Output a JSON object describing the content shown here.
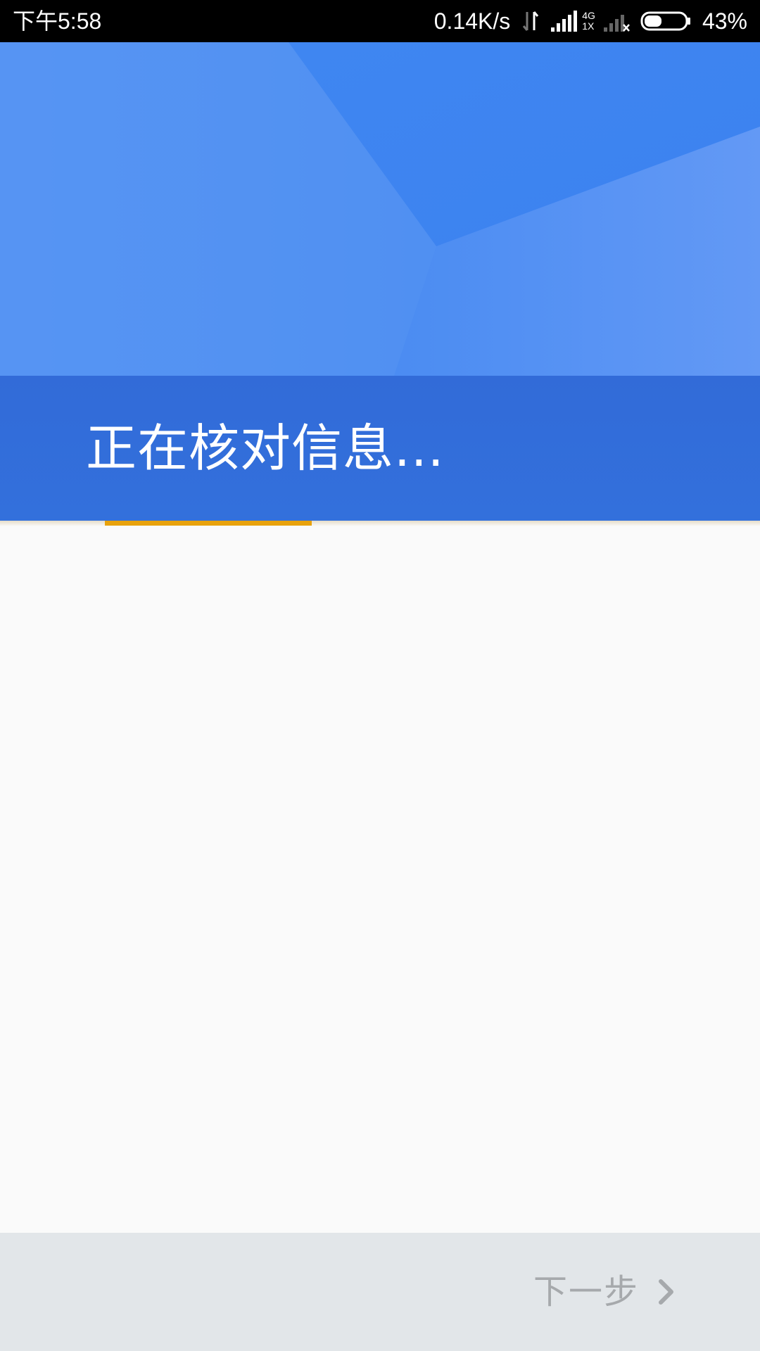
{
  "status_bar": {
    "time": "下午5:58",
    "net_speed": "0.14K/s",
    "net_type_top": "4G",
    "net_type_bottom": "1X",
    "battery": "43%",
    "battery_level": 0.43
  },
  "header": {
    "title": "正在核对信息...",
    "progress": 0.33
  },
  "footer": {
    "next_label": "下一步"
  },
  "colors": {
    "header_blue": "#4f8ef2",
    "band_blue": "#3370dc",
    "progress": "#e8a20c",
    "disabled_text": "#a6a9ac",
    "bottom_bar": "#e2e6e9"
  },
  "icons": {
    "data_activity": "data-activity-icon",
    "signal": "signal-icon",
    "no_signal": "signal-no-service-icon",
    "battery": "battery-icon",
    "next": "chevron-right-icon"
  }
}
